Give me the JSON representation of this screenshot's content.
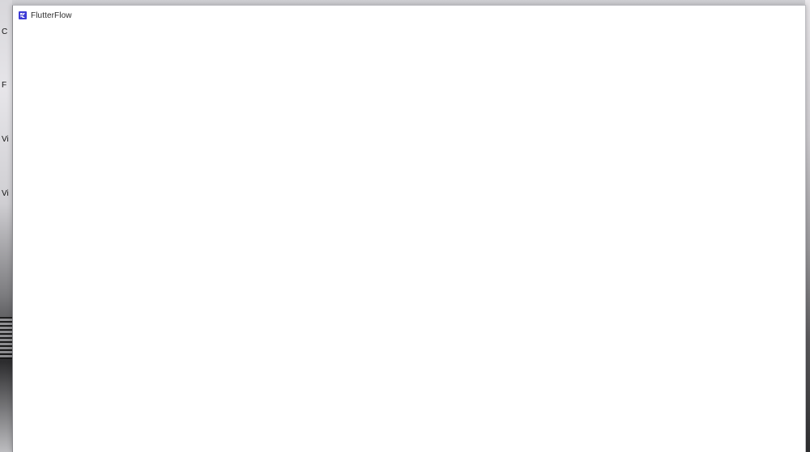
{
  "window": {
    "title": "FlutterFlow",
    "app_icon": "flutterflow-logo-icon",
    "accent_color": "#3c3ad6"
  },
  "desktop": {
    "icon_labels": [
      "C",
      "F",
      "Vi",
      "Vi"
    ]
  }
}
